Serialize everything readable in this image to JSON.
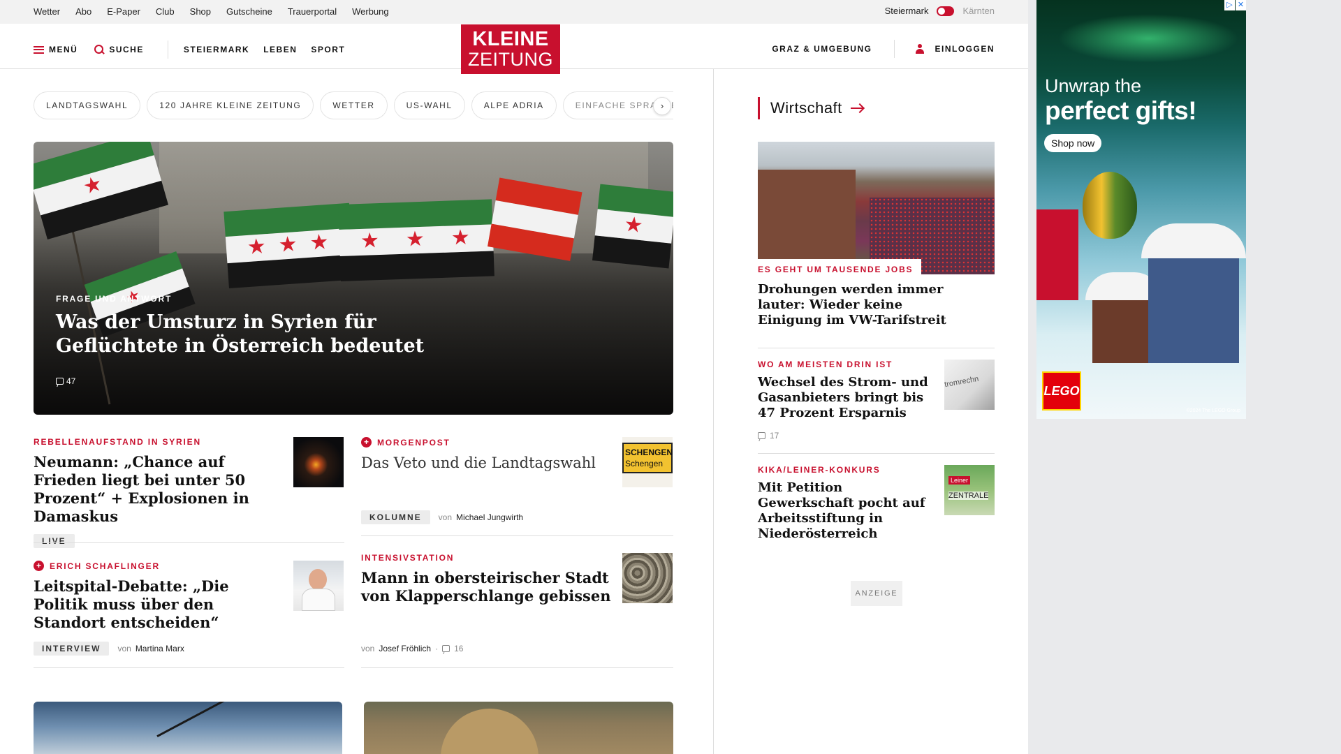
{
  "colors": {
    "accent": "#c8102e",
    "text": "#111111",
    "muted": "#888888"
  },
  "utility_bar": {
    "links": [
      "Wetter",
      "Abo",
      "E-Paper",
      "Club",
      "Shop",
      "Gutscheine",
      "Trauerportal",
      "Werbung"
    ],
    "region_active": "Steiermark",
    "region_inactive": "Kärnten"
  },
  "header": {
    "menu_label": "MENÜ",
    "search_label": "SUCHE",
    "categories": [
      "STEIERMARK",
      "LEBEN",
      "SPORT"
    ],
    "logo_line1": "KLEINE",
    "logo_line2": "ZEITUNG",
    "region_link": "GRAZ & UMGEBUNG",
    "login_label": "EINLOGGEN"
  },
  "chips": [
    "LANDTAGSWAHL",
    "120 JAHRE KLEINE ZEITUNG",
    "WETTER",
    "US-WAHL",
    "ALPE ADRIA",
    "EINFACHE SPRACHE"
  ],
  "chip_next_icon": "chevron-right-icon",
  "hero": {
    "kicker": "FRAGE UND ANTWORT",
    "title": "Was der Umsturz in Syrien für Geflüchtete in Österreich bedeutet",
    "comments": "47"
  },
  "teasers": [
    {
      "kicker": "REBELLENAUFSTAND IN SYRIEN",
      "title": "Neumann: „Chance auf Frieden liegt bei unter 50 Prozent“ + Explosionen in Damaskus",
      "badge": "LIVE"
    },
    {
      "kicker": "MORGENPOST",
      "title": "Das Veto und die Landtagswahl",
      "badge": "KOLUMNE",
      "by": "von",
      "author": "Michael Jungwirth",
      "thumb_text_1": "SCHENGEN",
      "thumb_text_2": "Schengen"
    },
    {
      "kicker": "ERICH SCHAFLINGER",
      "title": "Leitspital-Debatte: „Die Politik muss über den Standort entscheiden“",
      "badge": "INTERVIEW",
      "by": "von",
      "author": "Martina Marx"
    },
    {
      "kicker": "INTENSIVSTATION",
      "title": "Mann in obersteirischer Stadt von Klapperschlange gebissen",
      "by": "von",
      "author": "Josef Fröhlich",
      "comments": "16"
    }
  ],
  "sidebar": {
    "heading": "Wirtschaft",
    "lead": {
      "kicker": "ES GEHT UM TAUSENDE JOBS",
      "title": "Drohungen werden immer lauter: Wieder keine Einigung im VW-Tarifstreit"
    },
    "items": [
      {
        "kicker": "WO AM MEISTEN DRIN IST",
        "title": "Wechsel des Strom- und Gasanbieters bringt bis 47 Prozent Ersparnis",
        "comments": "17",
        "thumb_text": "tromrechn"
      },
      {
        "kicker": "KIKA/LEINER-KONKURS",
        "title": "Mit Petition Gewerkschaft pocht auf Arbeitsstiftung in Niederösterreich",
        "thumb_text_1": "Leiner",
        "thumb_text_2": "ZENTRALE"
      }
    ],
    "ad_label": "ANZEIGE"
  },
  "ad": {
    "headline_1": "Unwrap the",
    "headline_2": "perfect gifts!",
    "cta": "Shop now",
    "brand": "LEGO",
    "legal": "©2024 The LEGO Group",
    "controls": [
      "▷",
      "✕"
    ]
  }
}
